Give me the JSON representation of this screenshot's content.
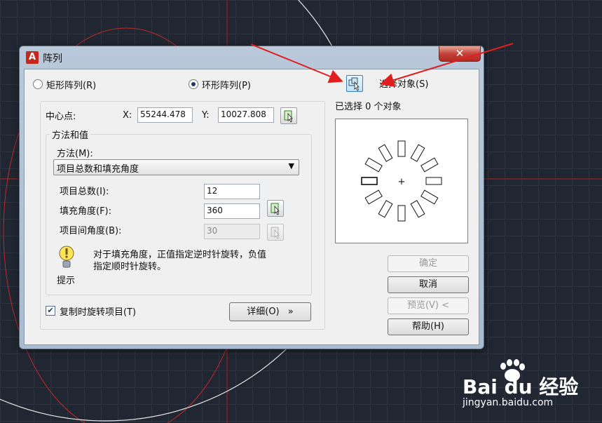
{
  "dialog": {
    "title": "阵列",
    "close_label": "✕"
  },
  "array_type": {
    "rect_label": "矩形阵列(R)",
    "polar_label": "环形阵列(P)",
    "selected": "polar"
  },
  "center": {
    "label": "中心点:",
    "x_label": "X:",
    "x_value": "55244.478",
    "y_label": "Y:",
    "y_value": "10027.808"
  },
  "method_group": {
    "caption": "方法和值",
    "method_label": "方法(M):",
    "method_value": "项目总数和填充角度",
    "total_label": "项目总数(I):",
    "total_value": "12",
    "fill_label": "填充角度(F):",
    "fill_value": "360",
    "between_label": "项目间角度(B):",
    "between_value": "30",
    "hint_text_1": "对于填充角度，正值指定逆时针旋转，负值",
    "hint_text_2": "指定顺时针旋转。",
    "hint_label": "提示"
  },
  "rotate_checkbox": {
    "label": "复制时旋转项目(T)",
    "checked": true
  },
  "more_button": {
    "label": "详细(O)",
    "chevron": "»"
  },
  "select_objects": {
    "label": "选择对象(S)",
    "status": "已选择 0 个对象"
  },
  "buttons": {
    "ok": "确定",
    "cancel": "取消",
    "preview": "预览(V) <",
    "help": "帮助(H)"
  },
  "preview": {
    "item_count": 12,
    "center_mark": "+"
  },
  "watermark": {
    "brand": "Bai du 经验",
    "url": "jingyan.baidu.com"
  },
  "colors": {
    "cad_background": "#212732",
    "annotation_arrow": "#e01e1e",
    "dialog_frame": "#b9c9da"
  }
}
